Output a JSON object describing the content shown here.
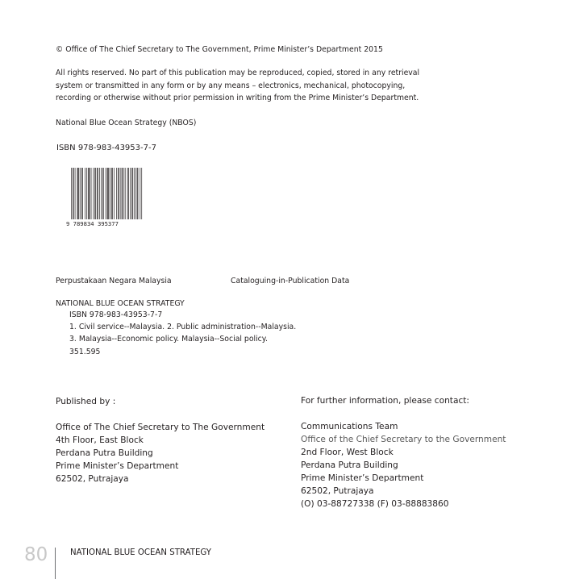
{
  "copyright": "© Office of The Chief Secretary to The Government, Prime Minister’s Department 2015",
  "rights_lines": [
    "All rights reserved. No part of this publication may be reproduced, copied, stored in any retrieval",
    "system or transmitted in any form or by any means – electronics, mechanical, photocopying,",
    "recording or otherwise without prior permission in writing from the Prime Minister’s Department."
  ],
  "nbos": "National Blue Ocean Strategy (NBOS)",
  "isbn": "ISBN 978-983-43953-7-7",
  "barcode_digits": "9 789834 395377",
  "cip": {
    "library": "Perpustakaan Negara Malaysia",
    "title": "Cataloguing-in-Publication Data"
  },
  "catalogue": {
    "title": "NATIONAL BLUE OCEAN STRATEGY",
    "lines": [
      "ISBN  978-983-43953-7-7",
      "1. Civil service--Malaysia.  2. Public administration--Malaysia.",
      "3. Malaysia--Economic policy.  Malaysia--Social policy.",
      "351.595"
    ]
  },
  "published": {
    "heading": "Published by :",
    "lines": [
      "Office of The Chief Secretary to The Government",
      "4th Floor, East Block",
      "Perdana Putra Building",
      "Prime Minister’s Department",
      "62502, Putrajaya"
    ]
  },
  "contact": {
    "heading": "For further information, please contact:",
    "lines": [
      "Communications Team",
      "Office of the Chief Secretary to the Government",
      "2nd Floor, West Block",
      "Perdana Putra Building",
      "Prime Minister’s Department",
      "62502, Putrajaya",
      "(O) 03-88727338  (F) 03-88883860"
    ]
  },
  "footer": {
    "page_number": "80",
    "title": "NATIONAL BLUE OCEAN STRATEGY"
  }
}
